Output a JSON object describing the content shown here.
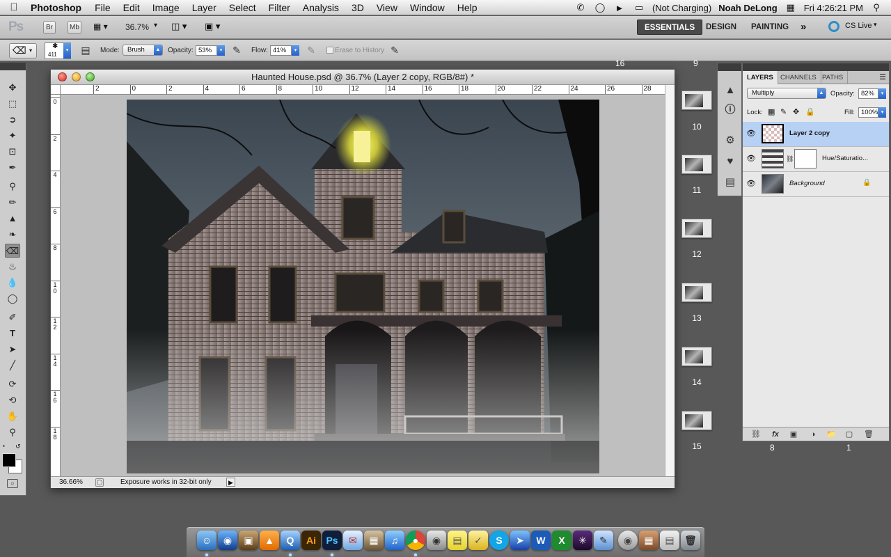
{
  "menubar": {
    "app_name": "Photoshop",
    "items": [
      "File",
      "Edit",
      "Image",
      "Layer",
      "Select",
      "Filter",
      "Analysis",
      "3D",
      "View",
      "Window",
      "Help"
    ],
    "battery": "(Not Charging)",
    "user": "Noah DeLong",
    "clock": "Fri 4:26:21 PM"
  },
  "appbar": {
    "logo": "Ps",
    "bridge": "Br",
    "minibridge": "Mb",
    "zoom": "36.7%",
    "workspaces": [
      "ESSENTIALS",
      "DESIGN",
      "PAINTING"
    ],
    "more": "»",
    "cs_live": "CS Live"
  },
  "options": {
    "brush_size": "411",
    "mode_label": "Mode:",
    "mode_value": "Brush",
    "opacity_label": "Opacity:",
    "opacity_value": "53%",
    "flow_label": "Flow:",
    "flow_value": "41%",
    "erase_history": "Erase to History"
  },
  "document": {
    "title": "Haunted House.psd @ 36.7% (Layer 2 copy, RGB/8#) *",
    "h_ruler": [
      "2",
      "0",
      "2",
      "4",
      "6",
      "8",
      "10",
      "12",
      "14",
      "16",
      "18",
      "20",
      "22",
      "24",
      "26",
      "28"
    ],
    "v_ruler": [
      "0",
      "2",
      "4",
      "6",
      "8",
      "10",
      "12",
      "14",
      "16",
      "18"
    ],
    "zoom_status": "36.66%",
    "status_text": "Exposure works in 32-bit only"
  },
  "history_thumbs": [
    "10",
    "11",
    "12",
    "13",
    "14",
    "15"
  ],
  "top_clipped_labels": [
    "16",
    "9"
  ],
  "layers_panel": {
    "tabs": [
      "LAYERS",
      "CHANNELS",
      "PATHS"
    ],
    "blend_mode": "Multiply",
    "opacity_label": "Opacity:",
    "opacity_value": "82%",
    "lock_label": "Lock:",
    "fill_label": "Fill:",
    "fill_value": "100%",
    "layers": [
      {
        "name": "Layer 2 copy",
        "selected": true
      },
      {
        "name": "Hue/Saturatio...",
        "selected": false
      },
      {
        "name": "Background",
        "selected": false
      }
    ],
    "bottom_labels": [
      "8",
      "1"
    ]
  },
  "dock": {
    "apps": [
      "Finder",
      "Dashboard",
      "iPhoto",
      "VLC",
      "QuickTime",
      "Illustrator",
      "Photoshop",
      "Mail",
      "Preview",
      "iTunes",
      "Chrome",
      "Screenshot",
      "Stickies",
      "Tasks",
      "Skype",
      "Safari",
      "Word",
      "Excel",
      "Aperture",
      "Utility",
      "Disk Utility",
      "Photos",
      "Desktop",
      "Trash"
    ]
  },
  "colors": {
    "accent": "#2a63c4",
    "workspace_active": "#4a4a4a",
    "layer_selected": "#b7d1f5"
  }
}
